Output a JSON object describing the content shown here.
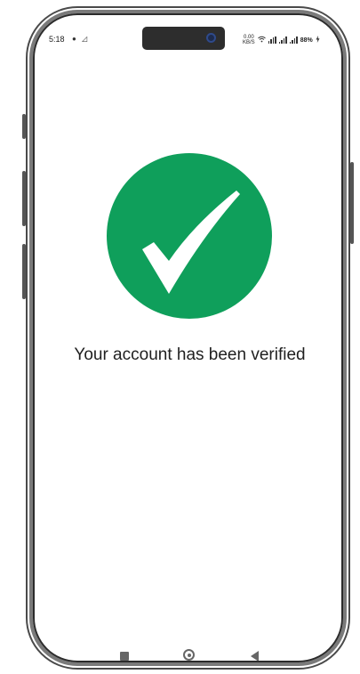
{
  "status_bar": {
    "time": "5:18",
    "left_icons": [
      "notification-dot-icon",
      "network-off-icon"
    ],
    "net_speed_value": "0.00",
    "net_speed_unit": "KB/S",
    "battery_text": "88%",
    "right_icons": [
      "wifi-icon",
      "volte-icon",
      "signal-icon",
      "signal-icon",
      "charging-icon"
    ]
  },
  "main": {
    "success_icon": "checkmark-icon",
    "success_color": "#0f9f5b",
    "message": "Your account has been verified"
  },
  "nav_bar": {
    "buttons": [
      "recents",
      "home",
      "back"
    ]
  }
}
